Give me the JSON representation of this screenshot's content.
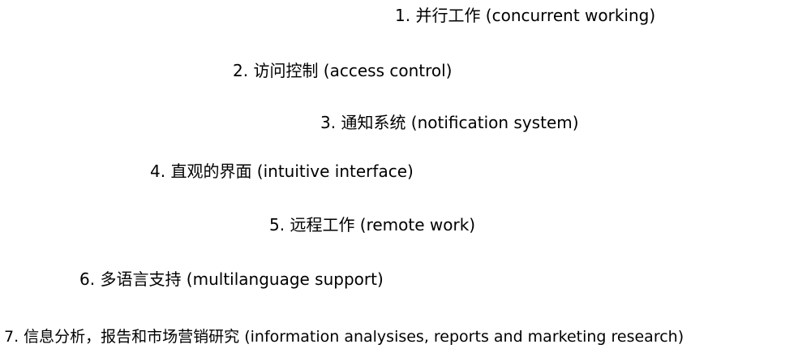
{
  "items": [
    {
      "text": "1. 并行工作 (concurrent working)"
    },
    {
      "text": "2. 访问控制 (access control)"
    },
    {
      "text": "3. 通知系统 (notification system)"
    },
    {
      "text": "4. 直观的界面 (intuitive interface)"
    },
    {
      "text": "5. 远程工作 (remote work)"
    },
    {
      "text": "6. 多语言支持 (multilanguage support)"
    },
    {
      "text": "7. 信息分析，报告和市场营销研究 (information analysises, reports and marketing research)"
    }
  ]
}
